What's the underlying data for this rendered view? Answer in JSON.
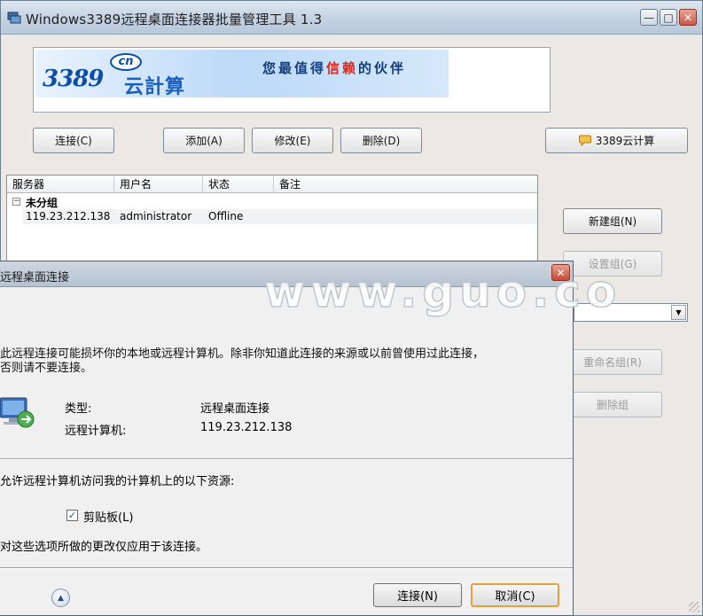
{
  "window": {
    "title": "Windows3389远程桌面连接器批量管理工具 1.3",
    "min_glyph": "—",
    "max_glyph": "□",
    "close_glyph": "✕"
  },
  "banner": {
    "logo_main": "3389",
    "logo_cn": "cn",
    "logo_sub": "云計算",
    "slogan_prefix": "您最值得",
    "slogan_highlight": "信赖",
    "slogan_suffix": "的伙伴"
  },
  "toolbar": {
    "connect": "连接(C)",
    "add": "添加(A)",
    "edit": "修改(E)",
    "delete": "删除(D)",
    "cloud": "3389云计算"
  },
  "server_list": {
    "columns": [
      "服务器",
      "用户名",
      "状态",
      "备注"
    ],
    "group": "未分组",
    "rows": [
      {
        "server": "119.23.212.138",
        "user": "administrator",
        "status": "Offline",
        "note": ""
      }
    ]
  },
  "group_panel": {
    "new_group": "新建组(N)",
    "set_group": "设置组(G)",
    "rename_group": "重命名组(R)",
    "delete_group": "删除组"
  },
  "watermark": "www.guo.co",
  "dialog": {
    "title": "远程桌面连接",
    "warning_line1": "此远程连接可能损坏你的本地或远程计算机。除非你知道此连接的来源或以前曾使用过此连接，",
    "warning_line2": "否则请不要连接。",
    "type_label": "类型:",
    "type_value": "远程桌面连接",
    "remote_label": "远程计算机:",
    "remote_value": "119.23.212.138",
    "allow_text": "允许远程计算机访问我的计算机上的以下资源:",
    "clipboard_label": "剪贴板(L)",
    "clipboard_checked": true,
    "apply_text": "对这些选项所做的更改仅应用于该连接。",
    "connect_btn": "连接(N)",
    "cancel_btn": "取消(C)"
  }
}
